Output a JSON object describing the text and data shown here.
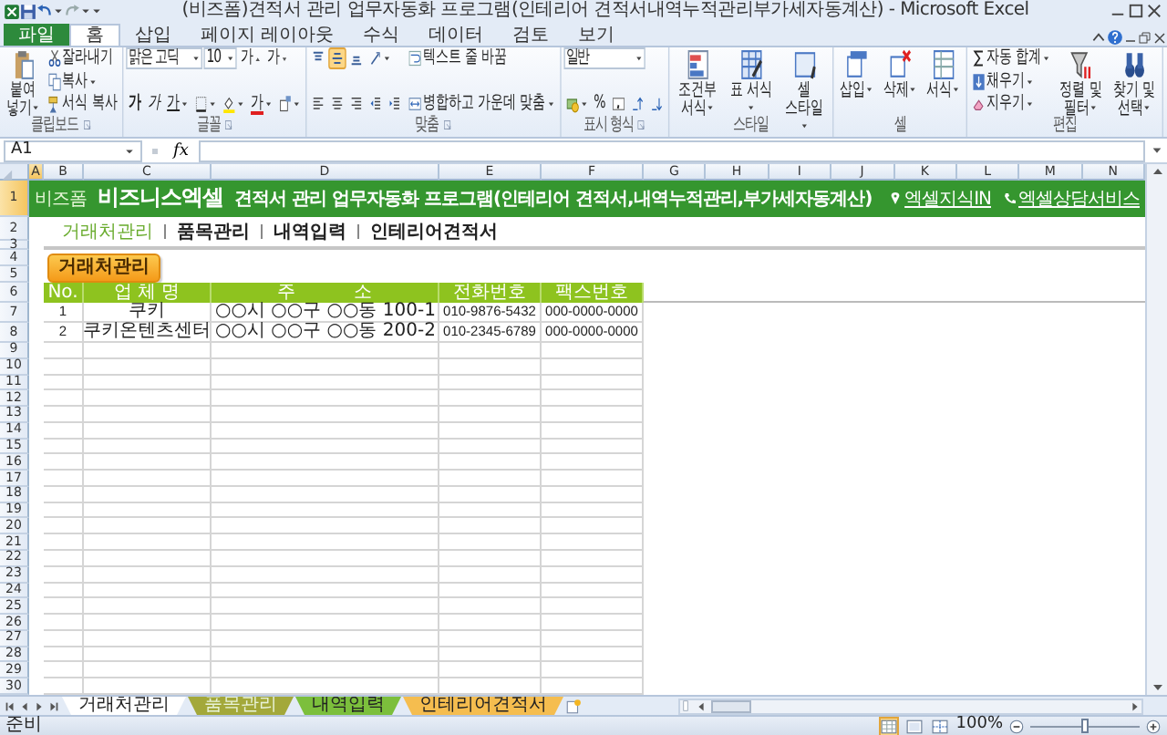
{
  "window": {
    "title": "(비즈폼)견적서 관리 업무자동화 프로그램(인테리어 견적서내역누적관리부가세자동계산)  -  Microsoft Excel"
  },
  "ribbon_tabs": [
    {
      "label": "파일",
      "kind": "file",
      "selected": false
    },
    {
      "label": "홈",
      "kind": "tab",
      "selected": true
    },
    {
      "label": "삽입",
      "kind": "tab",
      "selected": false
    },
    {
      "label": "페이지 레이아웃",
      "kind": "tab",
      "selected": false
    },
    {
      "label": "수식",
      "kind": "tab",
      "selected": false
    },
    {
      "label": "데이터",
      "kind": "tab",
      "selected": false
    },
    {
      "label": "검토",
      "kind": "tab",
      "selected": false
    },
    {
      "label": "보기",
      "kind": "tab",
      "selected": false
    }
  ],
  "ribbon": [
    {
      "label": "클립보드",
      "launcher": true,
      "cols": [
        [
          [
            {
              "kind": "large",
              "label": "붙여넣기",
              "menu": true
            }
          ]
        ],
        [
          [
            {
              "kind": "small",
              "label": "잘라내기",
              "menu": false
            }
          ],
          [
            {
              "kind": "small",
              "label": "복사",
              "menu": true
            }
          ],
          [
            {
              "kind": "small",
              "label": "서식 복사",
              "menu": false
            }
          ]
        ]
      ]
    },
    {
      "label": "글꼴",
      "launcher": true,
      "cols": [
        [
          [
            {
              "kind": "fontname",
              "value": "맑은 고딕",
              "menu": true
            },
            {
              "kind": "fontsize",
              "value": "10",
              "menu": true
            },
            {
              "kind": "grow",
              "text": "가",
              "menu": false
            },
            {
              "kind": "shrink",
              "text": "가",
              "menu": false
            }
          ],
          [
            {
              "kind": "bold",
              "text": "가",
              "menu": false
            },
            {
              "kind": "italic",
              "text": "가",
              "menu": false
            },
            {
              "kind": "underline",
              "text": "가",
              "menu": true
            },
            {
              "kind": "icon",
              "menu": true
            },
            {
              "kind": "icon",
              "menu": true
            },
            {
              "kind": "fontcolor",
              "text": "가",
              "menu": true
            },
            {
              "kind": "icon",
              "menu": true
            }
          ]
        ]
      ]
    },
    {
      "label": "맞춤",
      "launcher": true,
      "cols": [
        [
          [
            {
              "kind": "icon",
              "on": false,
              "menu": false
            },
            {
              "kind": "icon",
              "on": true,
              "menu": false
            },
            {
              "kind": "icon",
              "on": false,
              "menu": false
            },
            {
              "kind": "icon",
              "on": false,
              "menu": true
            }
          ],
          [
            {
              "kind": "icon",
              "on": false,
              "menu": false
            },
            {
              "kind": "icon",
              "on": false,
              "menu": false
            },
            {
              "kind": "icon",
              "on": false,
              "menu": false
            },
            {
              "kind": "icon",
              "on": false,
              "menu": false
            },
            {
              "kind": "icon",
              "on": false,
              "menu": false
            }
          ]
        ],
        [
          [
            {
              "kind": "small",
              "label": "텍스트 줄 바꿈",
              "menu": false
            }
          ],
          [
            {
              "kind": "small",
              "label": "병합하고 가운데 맞춤",
              "menu": true
            }
          ]
        ]
      ]
    },
    {
      "label": "표시 형식",
      "launcher": true,
      "cols": [
        [
          [
            {
              "kind": "format",
              "value": "일반",
              "menu": true
            }
          ],
          [
            {
              "kind": "icon",
              "menu": true
            },
            {
              "kind": "glyph",
              "text": "%",
              "menu": false
            },
            {
              "kind": "icon",
              "menu": false
            },
            {
              "kind": "icon",
              "menu": false
            },
            {
              "kind": "icon",
              "menu": false
            }
          ]
        ]
      ]
    },
    {
      "label": "스타일",
      "launcher": false,
      "cols": [
        [
          [
            {
              "kind": "large",
              "label": "조건부 서식",
              "menu": true
            }
          ]
        ],
        [
          [
            {
              "kind": "large",
              "label": "표 서식",
              "menu": true
            }
          ]
        ],
        [
          [
            {
              "kind": "large",
              "label": "셀 스타일",
              "menu": true
            }
          ]
        ]
      ]
    },
    {
      "label": "셀",
      "launcher": false,
      "cols": [
        [
          [
            {
              "kind": "large",
              "label": "삽입",
              "menu": true
            }
          ]
        ],
        [
          [
            {
              "kind": "large",
              "label": "삭제",
              "menu": true
            }
          ]
        ],
        [
          [
            {
              "kind": "large",
              "label": "서식",
              "menu": true
            }
          ]
        ]
      ]
    },
    {
      "label": "편집",
      "launcher": false,
      "cols": [
        [
          [
            {
              "kind": "small",
              "label": "자동 합계",
              "menu": true
            }
          ],
          [
            {
              "kind": "small",
              "label": "채우기",
              "menu": true
            }
          ],
          [
            {
              "kind": "small",
              "label": "지우기",
              "menu": true
            }
          ]
        ],
        [
          [
            {
              "kind": "large",
              "label": "정렬 및 필터",
              "menu": true
            }
          ]
        ],
        [
          [
            {
              "kind": "large",
              "label": "찾기 및 선택",
              "menu": true
            }
          ]
        ]
      ]
    }
  ],
  "formula_bar": {
    "name_box": "A1",
    "function_label": "fx"
  },
  "sheet": {
    "columns": [
      {
        "label": "A",
        "selected": true
      },
      {
        "label": "B",
        "selected": false
      },
      {
        "label": "C",
        "selected": false
      },
      {
        "label": "D",
        "selected": false
      },
      {
        "label": "E",
        "selected": false
      },
      {
        "label": "F",
        "selected": false
      },
      {
        "label": "G",
        "selected": false
      },
      {
        "label": "H",
        "selected": false
      },
      {
        "label": "I",
        "selected": false
      },
      {
        "label": "J",
        "selected": false
      },
      {
        "label": "K",
        "selected": false
      },
      {
        "label": "L",
        "selected": false
      },
      {
        "label": "M",
        "selected": false
      },
      {
        "label": "N",
        "selected": false
      }
    ],
    "row_numbers": [
      {
        "label": "1",
        "selected": true
      },
      {
        "label": "2",
        "selected": false
      },
      {
        "label": "3",
        "selected": false
      },
      {
        "label": "4",
        "selected": false
      },
      {
        "label": "5",
        "selected": false
      },
      {
        "label": "6",
        "selected": false
      },
      {
        "label": "7",
        "selected": false
      },
      {
        "label": "8",
        "selected": false
      },
      {
        "label": "9",
        "selected": false
      },
      {
        "label": "10",
        "selected": false
      },
      {
        "label": "11",
        "selected": false
      },
      {
        "label": "12",
        "selected": false
      },
      {
        "label": "13",
        "selected": false
      },
      {
        "label": "14",
        "selected": false
      },
      {
        "label": "15",
        "selected": false
      },
      {
        "label": "16",
        "selected": false
      },
      {
        "label": "17",
        "selected": false
      },
      {
        "label": "18",
        "selected": false
      },
      {
        "label": "19",
        "selected": false
      },
      {
        "label": "20",
        "selected": false
      },
      {
        "label": "21",
        "selected": false
      },
      {
        "label": "22",
        "selected": false
      },
      {
        "label": "23",
        "selected": false
      },
      {
        "label": "24",
        "selected": false
      },
      {
        "label": "25",
        "selected": false
      },
      {
        "label": "26",
        "selected": false
      },
      {
        "label": "27",
        "selected": false
      },
      {
        "label": "28",
        "selected": false
      },
      {
        "label": "29",
        "selected": false
      },
      {
        "label": "30",
        "selected": false
      }
    ],
    "banner": {
      "brand_small": "비즈폼",
      "brand": "비즈니스엑셀",
      "title": "견적서 관리 업무자동화 프로그램(인테리어 견적서,내역누적관리,부가세자동계산)",
      "links": [
        {
          "label": "엑셀지식IN",
          "kind": "pin"
        },
        {
          "label": "엑셀상담서비스",
          "kind": "phone"
        }
      ]
    },
    "nav": [
      {
        "label": "거래처관리",
        "selected": true
      },
      {
        "label": "품목관리",
        "selected": false
      },
      {
        "label": "내역입력",
        "selected": false
      },
      {
        "label": "인테리어견적서",
        "selected": false
      }
    ],
    "section_button": "거래처관리",
    "table": {
      "columns": [
        "No.",
        "업 체 명",
        "주          소",
        "전화번호",
        "팩스번호"
      ],
      "rows": [
        [
          "1",
          "쿠키",
          "○○시 ○○구 ○○동 100-1",
          "010-9876-5432",
          "000-0000-0000"
        ],
        [
          "2",
          "쿠키온텐츠센터",
          "○○시 ○○구 ○○동 200-2",
          "010-2345-6789",
          "000-0000-0000"
        ]
      ]
    }
  },
  "sheet_tabs": [
    {
      "label": "거래처관리",
      "selected": true
    },
    {
      "label": "품목관리",
      "selected": false,
      "color": "#a3a83a"
    },
    {
      "label": "내역입력",
      "selected": false,
      "color": "#7cbf3c"
    },
    {
      "label": "인테리어견적서",
      "selected": false,
      "color": "#f5bd4f"
    }
  ],
  "status_bar": {
    "status": "준비",
    "zoom": "100%",
    "zoom_level": {
      "level": 0.5
    }
  }
}
